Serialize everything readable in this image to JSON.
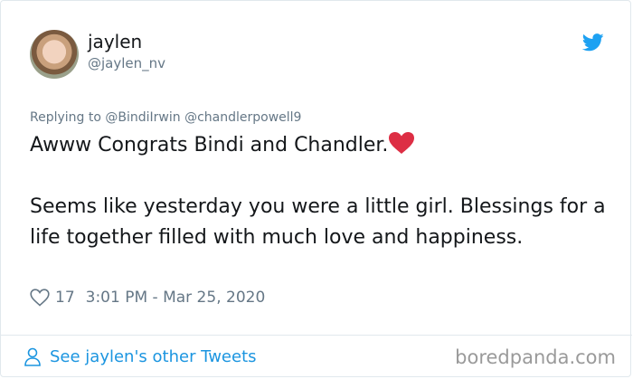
{
  "user": {
    "display_name": "jaylen",
    "handle": "@jaylen_nv"
  },
  "reply": {
    "text": "Replying to @BindiIrwin @chandlerpowell9"
  },
  "tweet": {
    "line1": "Awww Congrats Bindi and Chandler.",
    "line2": "Seems like yesterday you were a little girl. Blessings for a life together filled with much love and happiness."
  },
  "meta": {
    "likes": "17",
    "timestamp": "3:01 PM - Mar 25, 2020"
  },
  "footer": {
    "other_tweets": "See jaylen's other Tweets"
  },
  "watermark": "boredpanda.com",
  "colors": {
    "twitter_blue": "#1da1f2",
    "link_blue": "#1b95e0",
    "heart_red": "#e0245e",
    "muted": "#657786"
  },
  "icons": {
    "brand": "twitter-bird-icon",
    "emoji": "red-heart-icon",
    "like": "heart-outline-icon",
    "profile": "person-icon"
  }
}
